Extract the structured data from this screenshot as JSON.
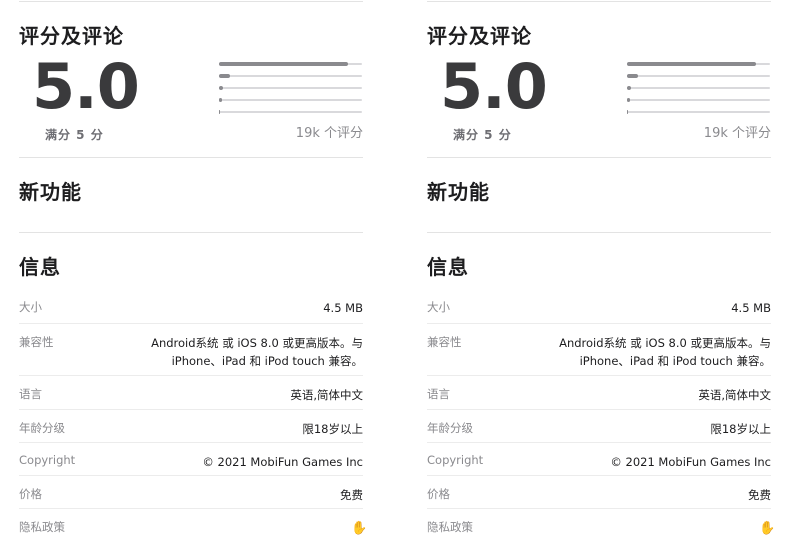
{
  "panels": [
    {
      "ratings": {
        "title": "评分及评论",
        "score": "5.0",
        "out_of": "满分 5 分",
        "count": "19k 个评分",
        "distribution": [
          0.9,
          0.08,
          0.03,
          0.02,
          0.01
        ]
      },
      "whats_new": {
        "title": "新功能"
      },
      "info": {
        "title": "信息",
        "rows": [
          {
            "label": "大小",
            "value": "4.5 MB"
          },
          {
            "label": "兼容性",
            "value_line1": "Android系统 或 iOS 8.0 或更高版本。与",
            "value_line2": "iPhone、iPad 和 iPod touch 兼容。"
          },
          {
            "label": "语言",
            "value": "英语,简体中文"
          },
          {
            "label": "年龄分级",
            "value": "限18岁以上"
          },
          {
            "label": "Copyright",
            "value": "© 2021 MobiFun Games Inc"
          },
          {
            "label": "价格",
            "value": "免费"
          },
          {
            "label": "隐私政策",
            "icon": "hand-icon"
          }
        ]
      }
    },
    {
      "ratings": {
        "title": "评分及评论",
        "score": "5.0",
        "out_of": "满分 5 分",
        "count": "19k 个评分",
        "distribution": [
          0.9,
          0.08,
          0.03,
          0.02,
          0.01
        ]
      },
      "whats_new": {
        "title": "新功能"
      },
      "info": {
        "title": "信息",
        "rows": [
          {
            "label": "大小",
            "value": "4.5 MB"
          },
          {
            "label": "兼容性",
            "value_line1": "Android系统 或 iOS 8.0 或更高版本。与",
            "value_line2": "iPhone、iPad 和 iPod touch 兼容。"
          },
          {
            "label": "语言",
            "value": "英语,简体中文"
          },
          {
            "label": "年龄分级",
            "value": "限18岁以上"
          },
          {
            "label": "Copyright",
            "value": "© 2021 MobiFun Games Inc"
          },
          {
            "label": "价格",
            "value": "免费"
          },
          {
            "label": "隐私政策",
            "icon": "hand-icon"
          }
        ]
      }
    }
  ]
}
